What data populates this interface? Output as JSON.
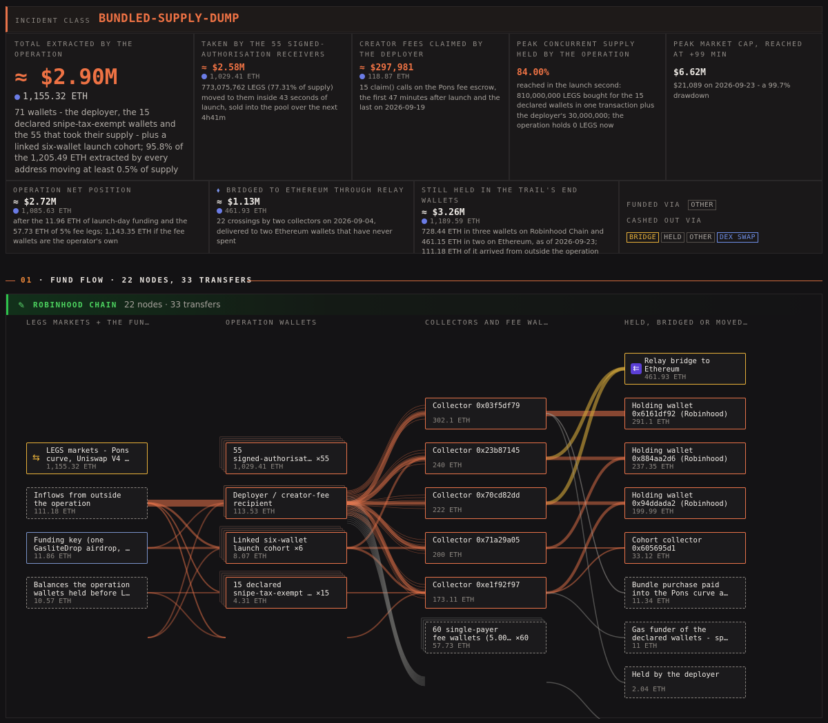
{
  "header": {
    "label": "INCIDENT CLASS",
    "value": "BUNDLED-SUPPLY-DUMP"
  },
  "stats_top": [
    {
      "label": "TOTAL EXTRACTED BY THE OPERATION",
      "value": "≈ $2.90M",
      "eth": "1,155.32 ETH",
      "desc": "71 wallets - the deployer, the 15 declared snipe-tax-exempt wallets and the 55 that took their supply - plus a linked six-wallet launch cohort; 95.8% of the 1,205.49 ETH extracted by every address moving at least 0.5% of supply"
    },
    {
      "label": "TAKEN BY THE 55 SIGNED-AUTHORISATION RECEIVERS",
      "value": "≈ $2.58M",
      "eth": "1,029.41 ETH",
      "desc": "773,075,762 LEGS (77.31% of supply) moved to them inside 43 seconds of launch, sold into the pool over the next 4h41m"
    },
    {
      "label": "CREATOR FEES CLAIMED BY THE DEPLOYER",
      "value": "≈ $297,981",
      "eth": "118.87 ETH",
      "desc": "15 claim() calls on the Pons fee escrow, the first 47 minutes after launch and the last on 2026-09-19"
    },
    {
      "label": "PEAK CONCURRENT SUPPLY HELD BY THE OPERATION",
      "value": "84.00%",
      "eth": "",
      "desc": "reached in the launch second: 810,000,000 LEGS bought for the 15 declared wallets in one transaction plus the deployer's 30,000,000; the operation holds 0 LEGS now"
    },
    {
      "label": "PEAK MARKET CAP, REACHED AT +99 MIN",
      "value": "$6.62M",
      "eth": "",
      "desc": "$21,089 on 2026-09-23 - a 99.7% drawdown"
    }
  ],
  "stats_bottom": [
    {
      "label": "OPERATION NET POSITION",
      "value": "≈ $2.72M",
      "eth": "1,085.63 ETH",
      "desc": "after the 11.96 ETH of launch-day funding and the 57.73 ETH of 5% fee legs; 1,143.35 ETH if the fee wallets are the operator's own"
    },
    {
      "label": "BRIDGED TO ETHEREUM THROUGH RELAY",
      "value": "≈ $1.13M",
      "eth": "461.93 ETH",
      "desc": "22 crossings by two collectors on 2026-09-04, delivered to two Ethereum wallets that have never spent"
    },
    {
      "label": "STILL HELD IN THE TRAIL'S END WALLETS",
      "value": "≈ $3.26M",
      "eth": "1,189.59 ETH",
      "desc": "728.44 ETH in three wallets on Robinhood Chain and 461.15 ETH in two on Ethereum, as of 2026-09-23; 111.18 ETH of it arrived from outside the operation"
    }
  ],
  "funded": {
    "label": "FUNDED VIA",
    "tags": [
      "OTHER"
    ]
  },
  "cashed": {
    "label": "CASHED OUT VIA",
    "tags": [
      "BRIDGE",
      "HELD",
      "OTHER",
      "DEX SWAP"
    ]
  },
  "colors": {
    "accent": "#ee7244",
    "bridge": "#e8b13a",
    "dex": "#6f8fe8",
    "chain": "#4cd35f"
  },
  "section": {
    "num": "01",
    "title": "FUND FLOW",
    "summary": "22 NODES, 33 TRANSFERS"
  },
  "chain": {
    "name": "ROBINHOOD CHAIN",
    "summary": "22 nodes · 33 transfers",
    "icon": "feather-icon"
  },
  "columns": [
    "LEGS MARKETS + THE FUN…",
    "OPERATION WALLETS",
    "COLLECTORS AND FEE WAL…",
    "HELD, BRIDGED OR MOVED…"
  ],
  "nodes": {
    "src_markets": {
      "line1": "LEGS markets - Pons",
      "line2": "curve, Uniswap V4 …",
      "eth": "1,155.32 ETH"
    },
    "src_inflows": {
      "line1": "Inflows from outside",
      "line2": "the operation",
      "eth": "111.18 ETH"
    },
    "src_funding": {
      "line1": "Funding key (one",
      "line2": "GasliteDrop airdrop, …",
      "eth": "11.86 ETH"
    },
    "src_balances": {
      "line1": "Balances the operation",
      "line2": "wallets held before L…",
      "eth": "10.57 ETH"
    },
    "op_55": {
      "line1": "55",
      "line2": "signed-authorisat… ×55",
      "eth": "1,029.41 ETH"
    },
    "op_deployer": {
      "line1": "Deployer / creator-fee",
      "line2": "recipient",
      "eth": "113.53 ETH"
    },
    "op_cohort": {
      "line1": "Linked six-wallet",
      "line2": "launch cohort ×6",
      "eth": "8.07 ETH"
    },
    "op_15": {
      "line1": "15 declared",
      "line2": "snipe-tax-exempt … ×15",
      "eth": "4.31 ETH"
    },
    "col_1": {
      "line1": "Collector 0x03f5df79",
      "line2": "",
      "eth": "302.1 ETH"
    },
    "col_2": {
      "line1": "Collector 0x23b87145",
      "line2": "",
      "eth": "240 ETH"
    },
    "col_3": {
      "line1": "Collector 0x70cd82dd",
      "line2": "",
      "eth": "222 ETH"
    },
    "col_4": {
      "line1": "Collector 0x71a29a05",
      "line2": "",
      "eth": "200 ETH"
    },
    "col_5": {
      "line1": "Collector 0xe1f92f97",
      "line2": "",
      "eth": "173.11 ETH"
    },
    "col_fee": {
      "line1": "60 single-payer",
      "line2": "fee wallets (5.00… ×60",
      "eth": "57.73 ETH"
    },
    "dst_relay": {
      "line1": "Relay bridge to",
      "line2": "Ethereum",
      "eth": "461.93 ETH"
    },
    "dst_h1": {
      "line1": "Holding wallet",
      "line2": "0x6161df92 (Robinhood)",
      "eth": "291.1 ETH"
    },
    "dst_h2": {
      "line1": "Holding wallet",
      "line2": "0x884aa2d6 (Robinhood)",
      "eth": "237.35 ETH"
    },
    "dst_h3": {
      "line1": "Holding wallet",
      "line2": "0x94ddada2 (Robinhood)",
      "eth": "199.99 ETH"
    },
    "dst_cohort": {
      "line1": "Cohort collector",
      "line2": "0x605695d1",
      "eth": "33.12 ETH"
    },
    "dst_bundle": {
      "line1": "Bundle purchase paid",
      "line2": "into the Pons curve a…",
      "eth": "11.34 ETH"
    },
    "dst_gas": {
      "line1": "Gas funder of the",
      "line2": "declared wallets - sp…",
      "eth": "11 ETH"
    },
    "dst_deployer": {
      "line1": "Held by the deployer",
      "line2": "",
      "eth": "2.04 ETH"
    }
  }
}
